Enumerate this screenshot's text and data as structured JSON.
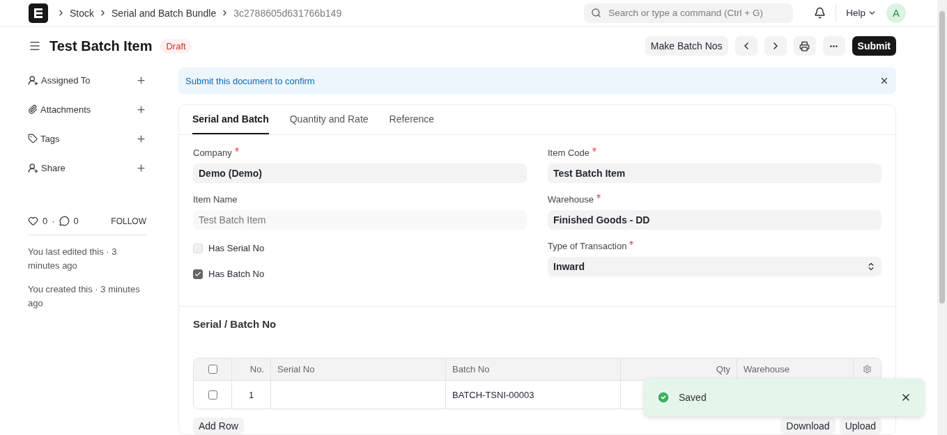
{
  "breadcrumbs": [
    {
      "label": "Stock",
      "current": false
    },
    {
      "label": "Serial and Batch Bundle",
      "current": false
    },
    {
      "label": "3c2788605d631766b149",
      "current": true
    }
  ],
  "search": {
    "placeholder": "Search or type a command (Ctrl + G)"
  },
  "help": "Help",
  "avatar": "A",
  "title": "Test Batch Item",
  "status": "Draft",
  "actions": {
    "make": "Make Batch Nos",
    "submit": "Submit"
  },
  "sidebar": {
    "items": [
      {
        "kind": "user",
        "label": "Assigned To"
      },
      {
        "kind": "clip",
        "label": "Attachments"
      },
      {
        "kind": "tag",
        "label": "Tags"
      },
      {
        "kind": "user",
        "label": "Share"
      }
    ],
    "likes": "0",
    "separator": "·",
    "comments": "0",
    "follow": "FOLLOW",
    "activity": [
      "You last edited this · 3 minutes ago",
      "You created this · 3 minutes ago"
    ]
  },
  "alert": "Submit this document to confirm",
  "tabs": [
    {
      "label": "Serial and Batch",
      "selected": true
    },
    {
      "label": "Quantity and Rate",
      "selected": false
    },
    {
      "label": "Reference",
      "selected": false
    }
  ],
  "left_fields": [
    {
      "kind": "input",
      "label": "Company",
      "required": true,
      "value": "Demo (Demo)",
      "disabled": false
    },
    {
      "kind": "input",
      "label": "Item Name",
      "required": false,
      "value": "Test Batch Item",
      "disabled": true
    },
    {
      "kind": "check",
      "label": "Has Serial No",
      "checked": false
    },
    {
      "kind": "check",
      "label": "Has Batch No",
      "checked": true
    }
  ],
  "right_fields": [
    {
      "kind": "input",
      "label": "Item Code",
      "required": true,
      "value": "Test Batch Item",
      "disabled": false
    },
    {
      "kind": "input",
      "label": "Warehouse",
      "required": true,
      "value": "Finished Goods - DD",
      "disabled": false
    },
    {
      "kind": "select",
      "label": "Type of Transaction",
      "required": true,
      "value": "Inward",
      "disabled": false
    }
  ],
  "section": "Serial / Batch No",
  "table": {
    "all_selected": false,
    "columns": [
      "No.",
      "Serial No",
      "Batch No",
      "Qty",
      "Warehouse"
    ],
    "rows": [
      {
        "selected": false,
        "cells": [
          "1",
          "",
          "BATCH-TSNI-00003",
          "",
          ""
        ]
      }
    ]
  },
  "table_buttons": {
    "add": "Add Row",
    "download": "Download",
    "upload": "Upload"
  },
  "toast": "Saved"
}
